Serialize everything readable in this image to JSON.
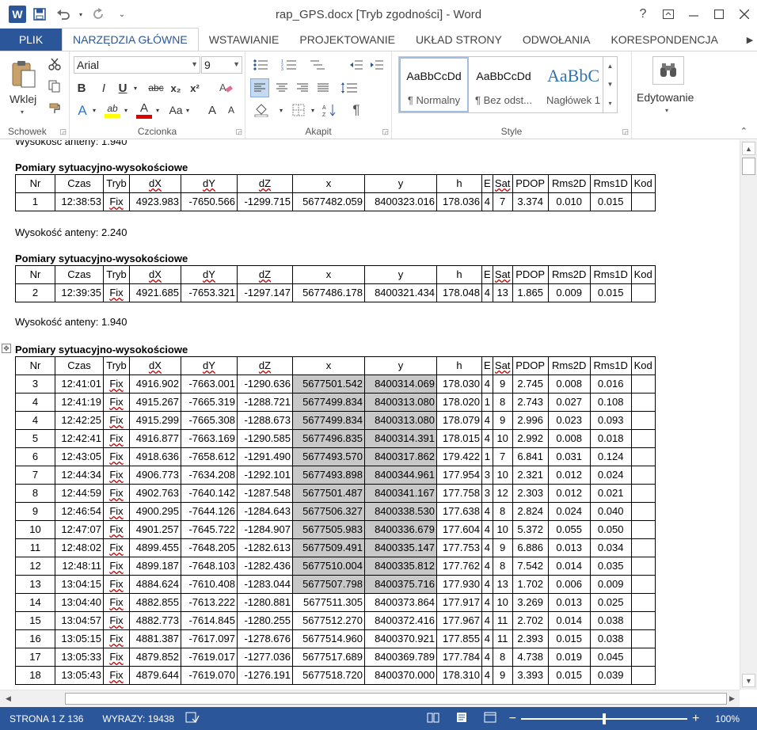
{
  "window": {
    "title": "rap_GPS.docx [Tryb zgodności] - Word",
    "help": "?",
    "controls": [
      "ribbon-display",
      "minimize",
      "maximize",
      "close"
    ]
  },
  "qat": {
    "logo": "W",
    "save_icon": "save-icon",
    "undo_icon": "undo-icon",
    "redo_icon": "redo-icon",
    "more": "customize-icon"
  },
  "ribbon_tabs": [
    {
      "label": "PLIK"
    },
    {
      "label": "NARZĘDZIA GŁÓWNE"
    },
    {
      "label": "WSTAWIANIE"
    },
    {
      "label": "PROJEKTOWANIE"
    },
    {
      "label": "UKŁAD STRONY"
    },
    {
      "label": "ODWOŁANIA"
    },
    {
      "label": "KORESPONDENCJA"
    }
  ],
  "ribbon": {
    "clipboard": {
      "paste_label": "Wklej",
      "group_label": "Schowek"
    },
    "font": {
      "font_name": "Arial",
      "font_size": "9",
      "bold": "B",
      "italic": "I",
      "underline": "U",
      "strike": "abc",
      "subscript": "x₂",
      "superscript": "x²",
      "text_effects": "A",
      "highlight": "ab",
      "font_color": "A",
      "change_case": "Aa",
      "grow": "A",
      "shrink": "A",
      "group_label": "Czcionka"
    },
    "paragraph": {
      "group_label": "Akapit",
      "pilcrow": "¶"
    },
    "styles": {
      "group_label": "Style",
      "items": [
        {
          "sample": "AaBbCcDd",
          "name": "¶ Normalny"
        },
        {
          "sample": "AaBbCcDd",
          "name": "¶ Bez odst..."
        },
        {
          "sample": "AaBbC",
          "name": "Nagłówek 1"
        }
      ]
    },
    "editing": {
      "label": "Edytowanie"
    }
  },
  "document": {
    "cut_line": "Wysokość anteny: 1.940",
    "blocks": [
      {
        "antenna": null,
        "heading": "Pomiary sytuacyjno-wysokościowe",
        "rows": [
          {
            "nr": "1",
            "czas": "12:38:53",
            "tryb": "Fix",
            "dx": "4923.983",
            "dy": "-7650.566",
            "dz": "-1299.715",
            "x": "5677482.059",
            "y": "8400323.016",
            "h": "178.036",
            "e": "4",
            "sat": "7",
            "pdop": "3.374",
            "rms2d": "0.010",
            "rms1d": "0.015",
            "kod": "",
            "shade": false
          }
        ]
      },
      {
        "antenna": "Wysokość anteny: 2.240",
        "heading": "Pomiary sytuacyjno-wysokościowe",
        "rows": [
          {
            "nr": "2",
            "czas": "12:39:35",
            "tryb": "Fix",
            "dx": "4921.685",
            "dy": "-7653.321",
            "dz": "-1297.147",
            "x": "5677486.178",
            "y": "8400321.434",
            "h": "178.048",
            "e": "4",
            "sat": "13",
            "pdop": "1.865",
            "rms2d": "0.009",
            "rms1d": "0.015",
            "kod": "",
            "shade": false
          }
        ]
      },
      {
        "antenna": "Wysokość anteny: 1.940",
        "heading": "Pomiary sytuacyjno-wysokościowe",
        "rows": [
          {
            "nr": "3",
            "czas": "12:41:01",
            "tryb": "Fix",
            "dx": "4916.902",
            "dy": "-7663.001",
            "dz": "-1290.636",
            "x": "5677501.542",
            "y": "8400314.069",
            "h": "178.030",
            "e": "4",
            "sat": "9",
            "pdop": "2.745",
            "rms2d": "0.008",
            "rms1d": "0.016",
            "kod": "",
            "shade": true
          },
          {
            "nr": "4",
            "czas": "12:41:19",
            "tryb": "Fix",
            "dx": "4915.267",
            "dy": "-7665.319",
            "dz": "-1288.721",
            "x": "5677499.834",
            "y": "8400313.080",
            "h": "178.020",
            "e": "1",
            "sat": "8",
            "pdop": "2.743",
            "rms2d": "0.027",
            "rms1d": "0.108",
            "kod": "",
            "shade": true
          },
          {
            "nr": "4",
            "czas": "12:42:25",
            "tryb": "Fix",
            "dx": "4915.299",
            "dy": "-7665.308",
            "dz": "-1288.673",
            "x": "5677499.834",
            "y": "8400313.080",
            "h": "178.079",
            "e": "4",
            "sat": "9",
            "pdop": "2.996",
            "rms2d": "0.023",
            "rms1d": "0.093",
            "kod": "",
            "shade": true
          },
          {
            "nr": "5",
            "czas": "12:42:41",
            "tryb": "Fix",
            "dx": "4916.877",
            "dy": "-7663.169",
            "dz": "-1290.585",
            "x": "5677496.835",
            "y": "8400314.391",
            "h": "178.015",
            "e": "4",
            "sat": "10",
            "pdop": "2.992",
            "rms2d": "0.008",
            "rms1d": "0.018",
            "kod": "",
            "shade": true
          },
          {
            "nr": "6",
            "czas": "12:43:05",
            "tryb": "Fix",
            "dx": "4918.636",
            "dy": "-7658.612",
            "dz": "-1291.490",
            "x": "5677493.570",
            "y": "8400317.862",
            "h": "179.422",
            "e": "1",
            "sat": "7",
            "pdop": "6.841",
            "rms2d": "0.031",
            "rms1d": "0.124",
            "kod": "",
            "shade": true
          },
          {
            "nr": "7",
            "czas": "12:44:34",
            "tryb": "Fix",
            "dx": "4906.773",
            "dy": "-7634.208",
            "dz": "-1292.101",
            "x": "5677493.898",
            "y": "8400344.961",
            "h": "177.954",
            "e": "3",
            "sat": "10",
            "pdop": "2.321",
            "rms2d": "0.012",
            "rms1d": "0.024",
            "kod": "",
            "shade": true
          },
          {
            "nr": "8",
            "czas": "12:44:59",
            "tryb": "Fix",
            "dx": "4902.763",
            "dy": "-7640.142",
            "dz": "-1287.548",
            "x": "5677501.487",
            "y": "8400341.167",
            "h": "177.758",
            "e": "3",
            "sat": "12",
            "pdop": "2.303",
            "rms2d": "0.012",
            "rms1d": "0.021",
            "kod": "",
            "shade": true
          },
          {
            "nr": "9",
            "czas": "12:46:54",
            "tryb": "Fix",
            "dx": "4900.295",
            "dy": "-7644.126",
            "dz": "-1284.643",
            "x": "5677506.327",
            "y": "8400338.530",
            "h": "177.638",
            "e": "4",
            "sat": "8",
            "pdop": "2.824",
            "rms2d": "0.024",
            "rms1d": "0.040",
            "kod": "",
            "shade": true
          },
          {
            "nr": "10",
            "czas": "12:47:07",
            "tryb": "Fix",
            "dx": "4901.257",
            "dy": "-7645.722",
            "dz": "-1284.907",
            "x": "5677505.983",
            "y": "8400336.679",
            "h": "177.604",
            "e": "4",
            "sat": "10",
            "pdop": "5.372",
            "rms2d": "0.055",
            "rms1d": "0.050",
            "kod": "",
            "shade": true
          },
          {
            "nr": "11",
            "czas": "12:48:02",
            "tryb": "Fix",
            "dx": "4899.455",
            "dy": "-7648.205",
            "dz": "-1282.613",
            "x": "5677509.491",
            "y": "8400335.147",
            "h": "177.753",
            "e": "4",
            "sat": "9",
            "pdop": "6.886",
            "rms2d": "0.013",
            "rms1d": "0.034",
            "kod": "",
            "shade": true
          },
          {
            "nr": "12",
            "czas": "12:48:11",
            "tryb": "Fix",
            "dx": "4899.187",
            "dy": "-7648.103",
            "dz": "-1282.436",
            "x": "5677510.004",
            "y": "8400335.812",
            "h": "177.762",
            "e": "4",
            "sat": "8",
            "pdop": "7.542",
            "rms2d": "0.014",
            "rms1d": "0.035",
            "kod": "",
            "shade": true
          },
          {
            "nr": "13",
            "czas": "13:04:15",
            "tryb": "Fix",
            "dx": "4884.624",
            "dy": "-7610.408",
            "dz": "-1283.044",
            "x": "5677507.798",
            "y": "8400375.716",
            "h": "177.930",
            "e": "4",
            "sat": "13",
            "pdop": "1.702",
            "rms2d": "0.006",
            "rms1d": "0.009",
            "kod": "",
            "shade": true
          },
          {
            "nr": "14",
            "czas": "13:04:40",
            "tryb": "Fix",
            "dx": "4882.855",
            "dy": "-7613.222",
            "dz": "-1280.881",
            "x": "5677511.305",
            "y": "8400373.864",
            "h": "177.917",
            "e": "4",
            "sat": "10",
            "pdop": "3.269",
            "rms2d": "0.013",
            "rms1d": "0.025",
            "kod": "",
            "shade": false
          },
          {
            "nr": "15",
            "czas": "13:04:57",
            "tryb": "Fix",
            "dx": "4882.773",
            "dy": "-7614.845",
            "dz": "-1280.255",
            "x": "5677512.270",
            "y": "8400372.416",
            "h": "177.967",
            "e": "4",
            "sat": "11",
            "pdop": "2.702",
            "rms2d": "0.014",
            "rms1d": "0.038",
            "kod": "",
            "shade": false
          },
          {
            "nr": "16",
            "czas": "13:05:15",
            "tryb": "Fix",
            "dx": "4881.387",
            "dy": "-7617.097",
            "dz": "-1278.676",
            "x": "5677514.960",
            "y": "8400370.921",
            "h": "177.855",
            "e": "4",
            "sat": "11",
            "pdop": "2.393",
            "rms2d": "0.015",
            "rms1d": "0.038",
            "kod": "",
            "shade": false
          },
          {
            "nr": "17",
            "czas": "13:05:33",
            "tryb": "Fix",
            "dx": "4879.852",
            "dy": "-7619.017",
            "dz": "-1277.036",
            "x": "5677517.689",
            "y": "8400369.789",
            "h": "177.784",
            "e": "4",
            "sat": "8",
            "pdop": "4.738",
            "rms2d": "0.019",
            "rms1d": "0.045",
            "kod": "",
            "shade": false
          },
          {
            "nr": "18",
            "czas": "13:05:43",
            "tryb": "Fix",
            "dx": "4879.644",
            "dy": "-7619.070",
            "dz": "-1276.191",
            "x": "5677518.720",
            "y": "8400370.000",
            "h": "178.310",
            "e": "4",
            "sat": "9",
            "pdop": "3.393",
            "rms2d": "0.015",
            "rms1d": "0.039",
            "kod": "",
            "shade": false
          }
        ]
      }
    ],
    "columns": [
      "Nr",
      "Czas",
      "Tryb",
      "dX",
      "dY",
      "dZ",
      "x",
      "y",
      "h",
      "E",
      "Sat",
      "PDOP",
      "Rms2D",
      "Rms1D",
      "Kod"
    ]
  },
  "statusbar": {
    "page": "STRONA 1 Z 136",
    "words": "WYRAZY: 19438",
    "zoom_minus": "−",
    "zoom_plus": "+",
    "zoom": "100%"
  },
  "colors": {
    "accent": "#2b579a",
    "highlight": "#c8c8c8",
    "spell": "#c00000"
  }
}
